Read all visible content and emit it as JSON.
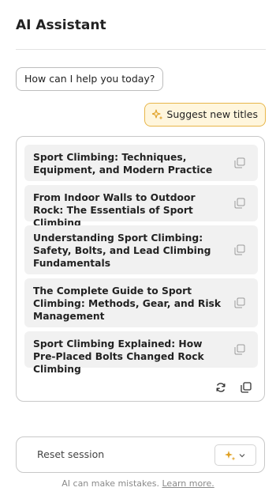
{
  "header": {
    "title": "AI Assistant"
  },
  "chat": {
    "bot_message": "How can I help you today?",
    "suggest_button": "Suggest new titles"
  },
  "titles": [
    "Sport Climbing: Techniques, Equipment, and Modern Practice",
    "From Indoor Walls to Outdoor Rock: The Essentials of Sport Climbing",
    "Understanding Sport Climbing: Safety, Bolts, and Lead Climbing Fundamentals",
    "The Complete Guide to Sport Climbing: Methods, Gear, and Risk Management",
    "Sport Climbing Explained: How Pre-Placed Bolts Changed Rock Climbing"
  ],
  "footer": {
    "reset_label": "Reset session",
    "disclaimer_text": "AI can make mistakes.",
    "learn_more": "Learn more."
  },
  "colors": {
    "suggest_bg": "#fff6dd",
    "suggest_border": "#e8b64a",
    "sparkle": "#e0a126",
    "item_bg": "#f1f1f1"
  },
  "icons": {
    "suggest": "sparkle-icon",
    "item_copy": "copy-icon",
    "regenerate": "refresh-icon",
    "copy_all": "copy-icon",
    "mode": "sparkle-icon",
    "dropdown": "chevron-down-icon"
  }
}
